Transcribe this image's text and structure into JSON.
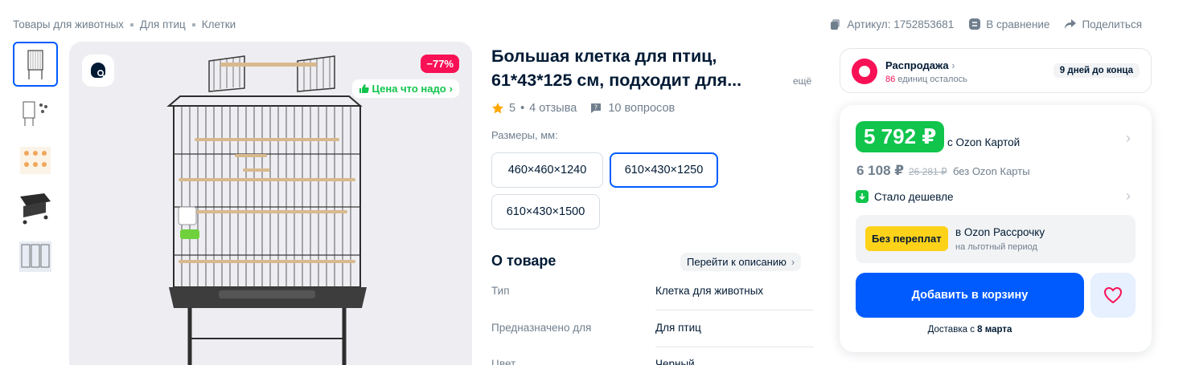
{
  "breadcrumb": [
    "Товары для животных",
    "Для птиц",
    "Клетки"
  ],
  "top_actions": {
    "sku": "Артикул: 1752853681",
    "compare": "В сравнение",
    "share": "Поделиться"
  },
  "gallery": {
    "discount": "−77%",
    "price_tag": "Цена что надо"
  },
  "product": {
    "title_line1": "Большая клетка для птиц,",
    "title_line2": "61*43*125 см, подходит для...",
    "more": "ещё",
    "rating": "5",
    "reviews": "4 отзыва",
    "questions": "10 вопросов",
    "sizes_label": "Размеры, мм:",
    "sizes": [
      "460×460×1240",
      "610×430×1250",
      "610×430×1500"
    ],
    "selected_size": "610×430×1250"
  },
  "about": {
    "title": "О товаре",
    "goto": "Перейти к описанию",
    "specs": [
      {
        "key": "Тип",
        "value": "Клетка для животных"
      },
      {
        "key": "Предназначено для",
        "value": "Для птиц"
      },
      {
        "key": "Цвет",
        "value": "Черный"
      }
    ]
  },
  "sale": {
    "title": "Распродажа",
    "count": "86",
    "count_text": "единиц осталось",
    "days_left": "9 дней до конца"
  },
  "price": {
    "ozon_price": "5 792 ₽",
    "with_card": "с Ozon Картой",
    "regular_price": "6 108 ₽",
    "old_price": "26 281 ₽",
    "without_card": "без Ozon Карты",
    "cheaper": "Стало дешевле",
    "no_overpay": "Без переплат",
    "installment_title": "в Ozon Рассрочку",
    "installment_sub": "на льготный период",
    "add_to_cart": "Добавить в корзину",
    "delivery_prefix": "Доставка с ",
    "delivery_date": "8 марта"
  },
  "colors": {
    "brand_blue": "#005bff",
    "green": "#10c44c",
    "pink": "#f91155",
    "yellow": "#ffd21a"
  }
}
